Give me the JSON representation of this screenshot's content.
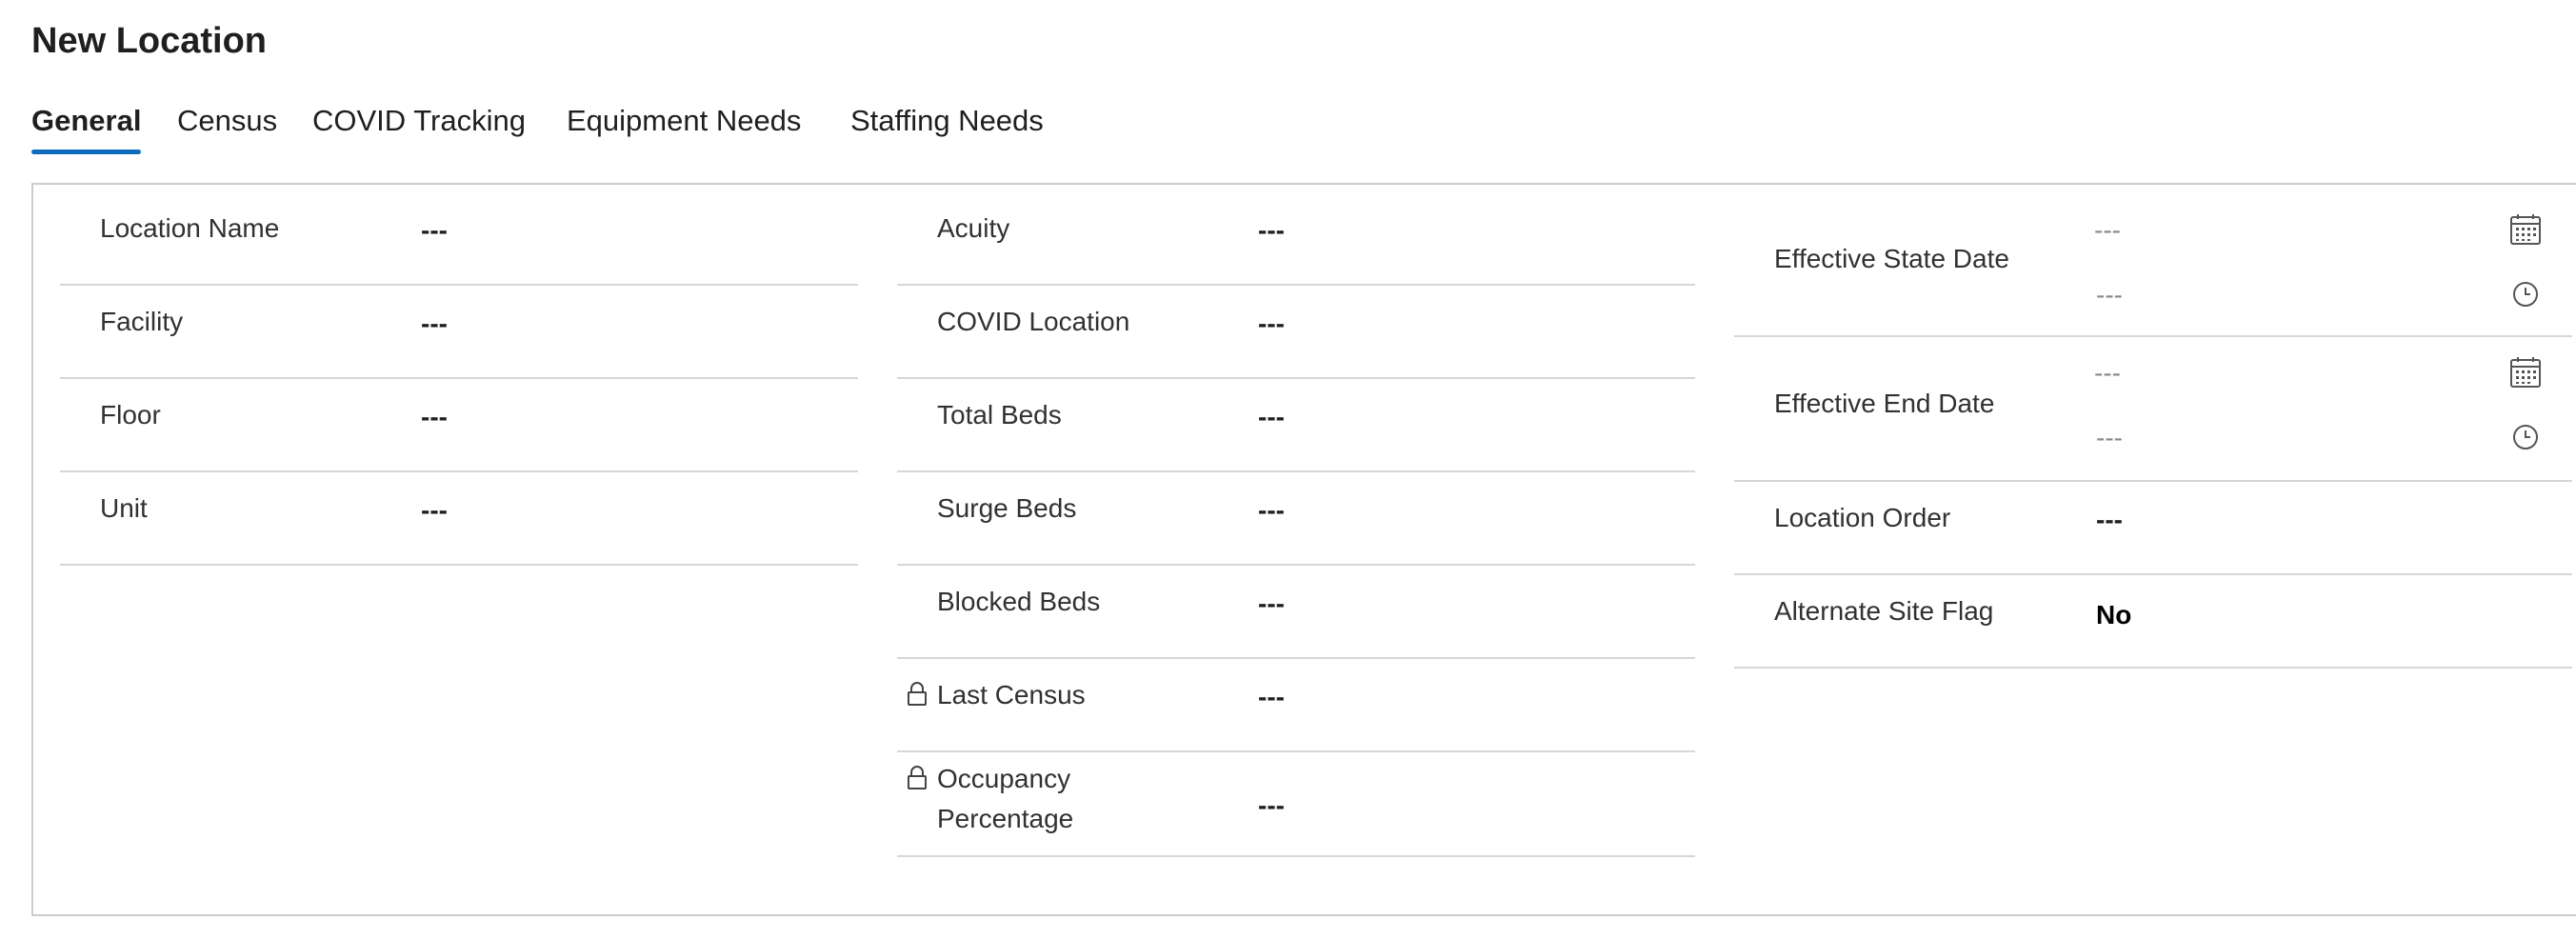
{
  "page": {
    "title": "New Location"
  },
  "tabs": [
    {
      "label": "General",
      "active": true
    },
    {
      "label": "Census",
      "active": false
    },
    {
      "label": "COVID Tracking",
      "active": false
    },
    {
      "label": "Equipment Needs",
      "active": false
    },
    {
      "label": "Staffing Needs",
      "active": false
    }
  ],
  "colors": {
    "accent": "#0f6cbd",
    "border": "#d6d6d6",
    "text": "#323130"
  },
  "column1": {
    "fields": [
      {
        "label": "Location Name",
        "value": "---"
      },
      {
        "label": "Facility",
        "value": "---"
      },
      {
        "label": "Floor",
        "value": "---"
      },
      {
        "label": "Unit",
        "value": "---"
      }
    ]
  },
  "column2": {
    "fields": [
      {
        "label": "Acuity",
        "value": "---"
      },
      {
        "label": "COVID Location",
        "value": "---"
      },
      {
        "label": "Total Beds",
        "value": "---"
      },
      {
        "label": "Surge Beds",
        "value": "---"
      },
      {
        "label": "Blocked Beds",
        "value": "---"
      },
      {
        "label": "Last Census",
        "value": "---",
        "locked": true,
        "icon": "lock-icon"
      },
      {
        "label_line1": "Occupancy",
        "label_line2": "Percentage",
        "value": "---",
        "locked": true,
        "icon": "lock-icon"
      }
    ]
  },
  "column3": {
    "effective_state_date": {
      "label": "Effective State Date",
      "date_value": "---",
      "time_value": "---",
      "date_icon": "calendar-icon",
      "time_icon": "clock-icon"
    },
    "effective_end_date": {
      "label": "Effective End Date",
      "date_value": "---",
      "time_value": "---",
      "date_icon": "calendar-icon",
      "time_icon": "clock-icon"
    },
    "location_order": {
      "label": "Location Order",
      "value": "---"
    },
    "alternate_site_flag": {
      "label": "Alternate Site Flag",
      "value": "No"
    }
  }
}
